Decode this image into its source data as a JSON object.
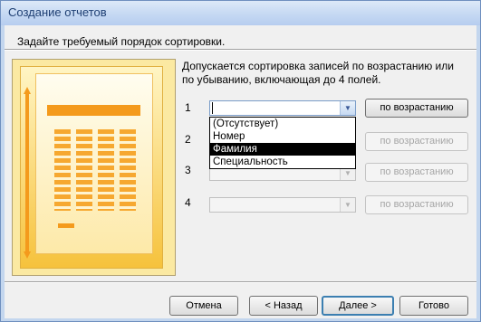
{
  "window": {
    "title": "Создание отчетов"
  },
  "wizard": {
    "subtitle": "Задайте требуемый порядок сортировки.",
    "description": "Допускается сортировка записей по возрастанию или по убыванию, включающая до 4 полей.",
    "rows": [
      {
        "number": "1",
        "value": "",
        "sort_label": "по возрастанию",
        "enabled": true
      },
      {
        "number": "2",
        "value": "",
        "sort_label": "по возрастанию",
        "enabled": false
      },
      {
        "number": "3",
        "value": "",
        "sort_label": "по возрастанию",
        "enabled": false
      },
      {
        "number": "4",
        "value": "",
        "sort_label": "по возрастанию",
        "enabled": false
      }
    ],
    "dropdown_options": [
      "(Отсутствует)",
      "Номер",
      "Фамилия",
      "Специальность"
    ],
    "dropdown_selected_index": 2
  },
  "footer": {
    "cancel": "Отмена",
    "back": "< Назад",
    "next": "Далее >",
    "finish": "Готово"
  },
  "colors": {
    "accent": "#3c7fb1",
    "selection": "#000000",
    "illustration_orange": "#f49a1c"
  },
  "icons": {
    "dropdown": "chevron-down-icon"
  }
}
